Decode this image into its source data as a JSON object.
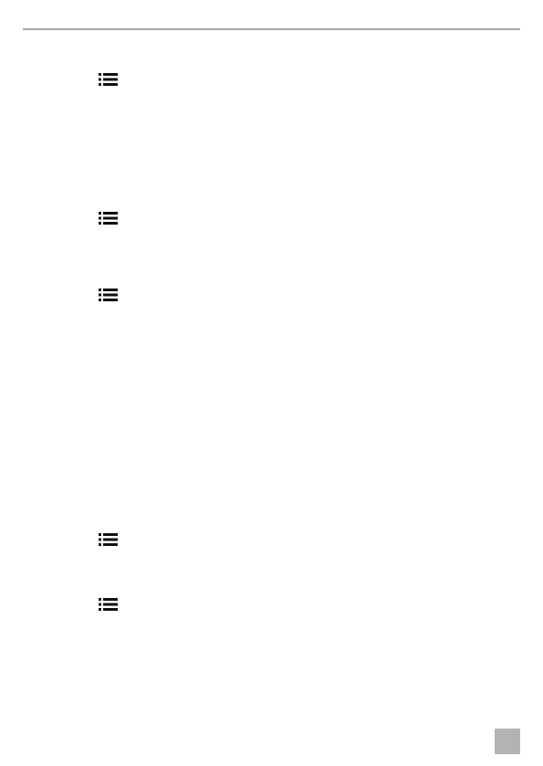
{
  "page": {
    "header_rule_color": "#a8a8a8",
    "page_tab_color": "#b3b3b3"
  },
  "icons": [
    {
      "name": "list-icon"
    },
    {
      "name": "list-icon"
    },
    {
      "name": "list-icon"
    },
    {
      "name": "list-icon"
    },
    {
      "name": "list-icon"
    }
  ]
}
